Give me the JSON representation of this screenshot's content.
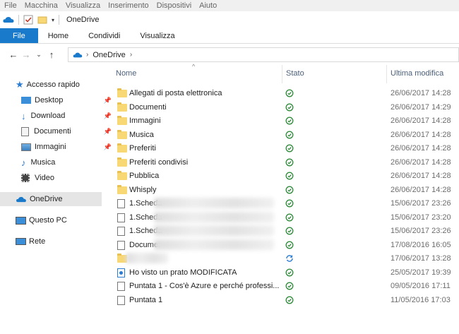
{
  "vm_menu": [
    "File",
    "Macchina",
    "Visualizza",
    "Inserimento",
    "Dispositivi",
    "Aiuto"
  ],
  "window": {
    "title": "OneDrive"
  },
  "ribbon": {
    "tabs": [
      "File",
      "Home",
      "Condividi",
      "Visualizza"
    ]
  },
  "address": {
    "crumbs": [
      "OneDrive"
    ]
  },
  "sidebar": {
    "quick_access": "Accesso rapido",
    "quick_items": [
      {
        "label": "Desktop",
        "pinned": true
      },
      {
        "label": "Download",
        "pinned": true
      },
      {
        "label": "Documenti",
        "pinned": true
      },
      {
        "label": "Immagini",
        "pinned": true
      },
      {
        "label": "Musica",
        "pinned": false
      },
      {
        "label": "Video",
        "pinned": false
      }
    ],
    "onedrive": "OneDrive",
    "this_pc": "Questo PC",
    "network": "Rete"
  },
  "columns": {
    "name": "Nome",
    "status": "Stato",
    "modified": "Ultima modifica"
  },
  "files": [
    {
      "name": "Allegati di posta elettronica",
      "type": "folder",
      "status": "synced",
      "date": "26/06/2017 14:28"
    },
    {
      "name": "Documenti",
      "type": "folder",
      "status": "synced",
      "date": "26/06/2017 14:29"
    },
    {
      "name": "Immagini",
      "type": "folder",
      "status": "synced",
      "date": "26/06/2017 14:28"
    },
    {
      "name": "Musica",
      "type": "folder",
      "status": "synced",
      "date": "26/06/2017 14:28"
    },
    {
      "name": "Preferiti",
      "type": "folder",
      "status": "synced",
      "date": "26/06/2017 14:28"
    },
    {
      "name": "Preferiti condivisi",
      "type": "folder",
      "status": "synced",
      "date": "26/06/2017 14:28"
    },
    {
      "name": "Pubblica",
      "type": "folder",
      "status": "synced",
      "date": "26/06/2017 14:28"
    },
    {
      "name": "Whisply",
      "type": "folder",
      "status": "synced",
      "date": "26/06/2017 14:28"
    },
    {
      "name": "1.Scheda",
      "type": "doc",
      "status": "synced",
      "date": "15/06/2017 23:26",
      "blurred": true
    },
    {
      "name": "1.Scheda",
      "type": "doc",
      "status": "synced",
      "date": "15/06/2017 23:20",
      "blurred": true
    },
    {
      "name": "1.Scheda",
      "type": "doc",
      "status": "synced",
      "date": "15/06/2017 23:26",
      "blurred": true
    },
    {
      "name": "Documer",
      "type": "doc",
      "status": "synced",
      "date": "17/08/2016 16:05",
      "blurred": true
    },
    {
      "name": "",
      "type": "shared-folder",
      "status": "syncing",
      "date": "17/06/2017 13:28",
      "blurred": true
    },
    {
      "name": "Ho visto un prato MODIFICATA",
      "type": "media",
      "status": "synced",
      "date": "25/05/2017 19:39"
    },
    {
      "name": "Puntata 1 - Cos'è Azure e perché professi...",
      "type": "doc",
      "status": "synced",
      "date": "09/05/2016 17:11"
    },
    {
      "name": "Puntata 1",
      "type": "doc",
      "status": "synced",
      "date": "11/05/2016 17:03"
    }
  ],
  "colors": {
    "accent": "#1979ca",
    "synced": "#2e8b3a",
    "syncing": "#2b7cd3",
    "folder": "#f8d775",
    "selected": "#e5e5e5"
  }
}
